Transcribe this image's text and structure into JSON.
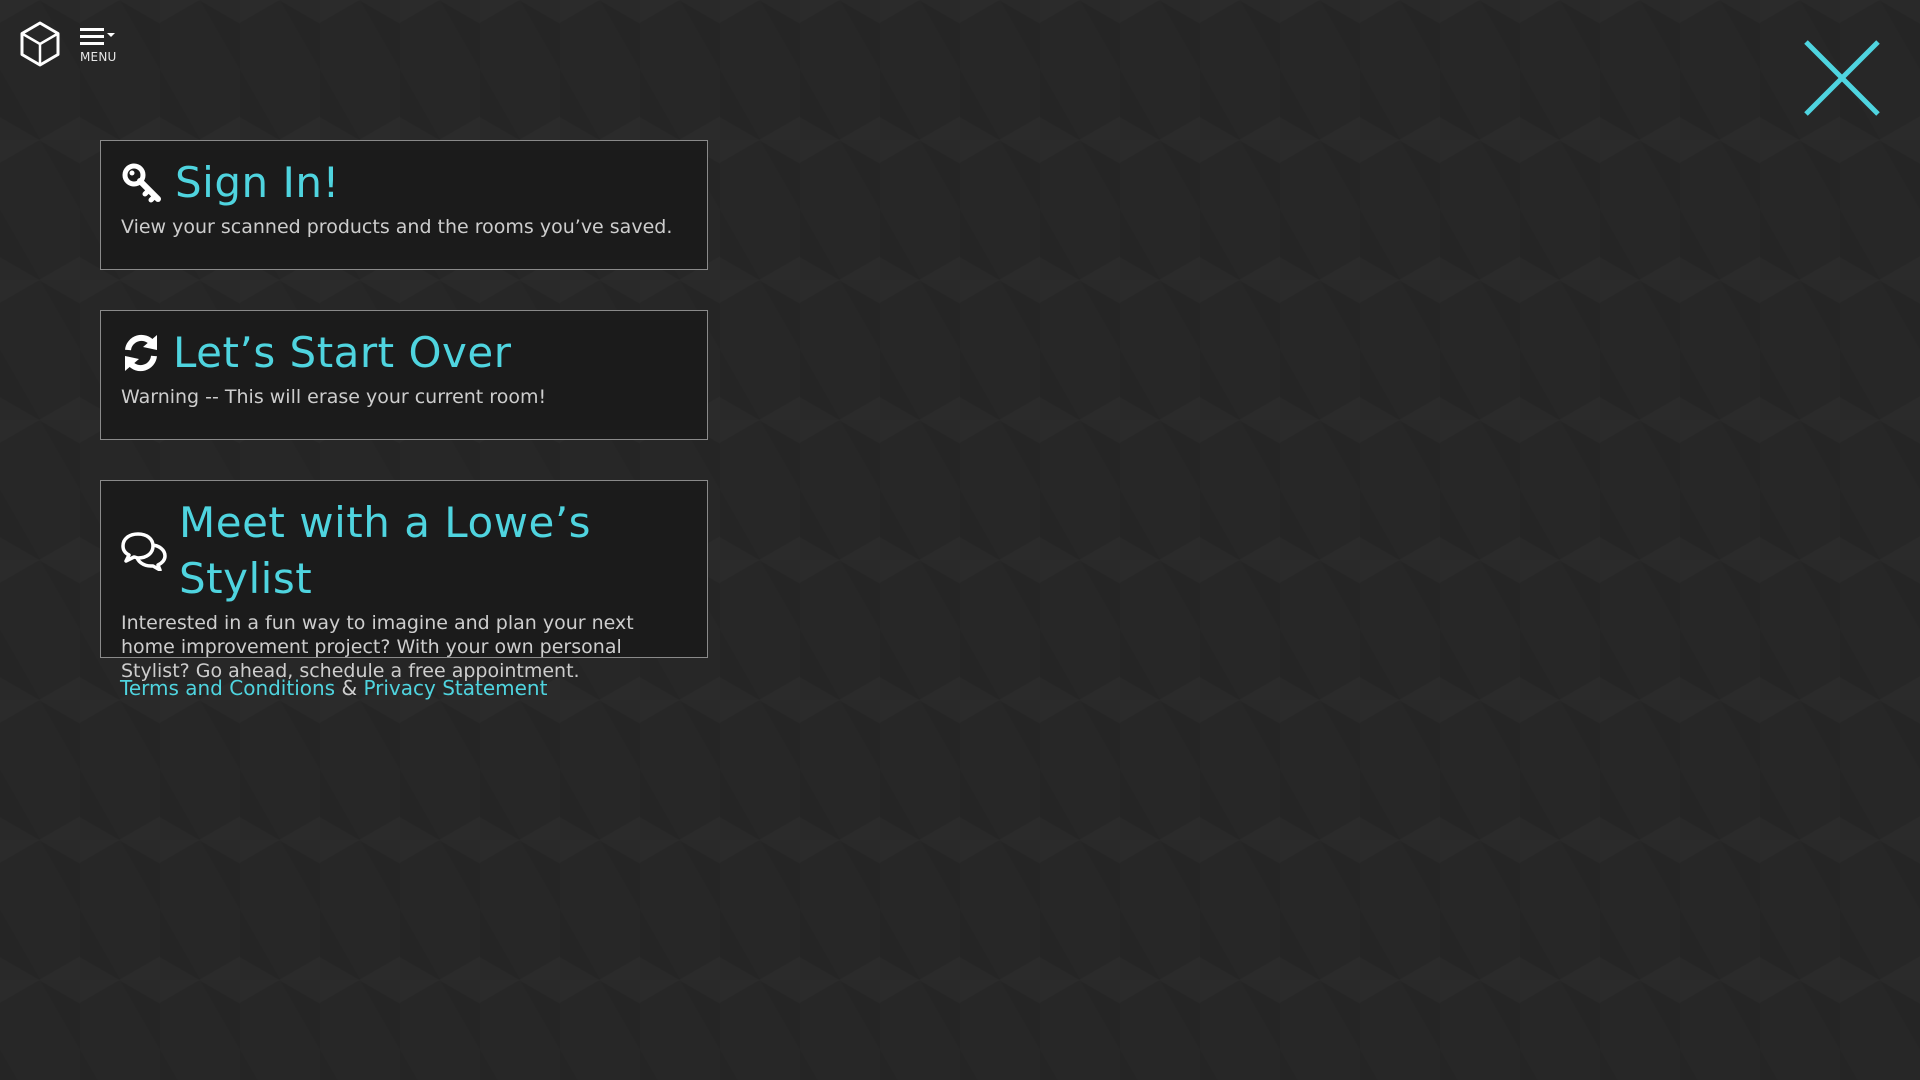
{
  "header": {
    "menu_label": "MENU"
  },
  "colors": {
    "accent": "#4fd4df",
    "card_background": "#1b1b1b",
    "page_background": "#272727",
    "body_text": "#cdcdcd"
  },
  "cards": [
    {
      "icon": "key-icon",
      "title": "Sign In!",
      "description": "View your scanned products and the rooms you’ve saved."
    },
    {
      "icon": "refresh-icon",
      "title": "Let’s Start Over",
      "description": "Warning -- This will erase your current room!"
    },
    {
      "icon": "chat-bubbles-icon",
      "title": "Meet with a Lowe’s Stylist",
      "description": "Interested in a fun way to imagine and plan your next home improvement project? With your own personal Stylist? Go ahead, schedule a free appointment."
    }
  ],
  "footer": {
    "terms_label": "Terms and Conditions",
    "separator": "&",
    "privacy_label": "Privacy Statement"
  }
}
